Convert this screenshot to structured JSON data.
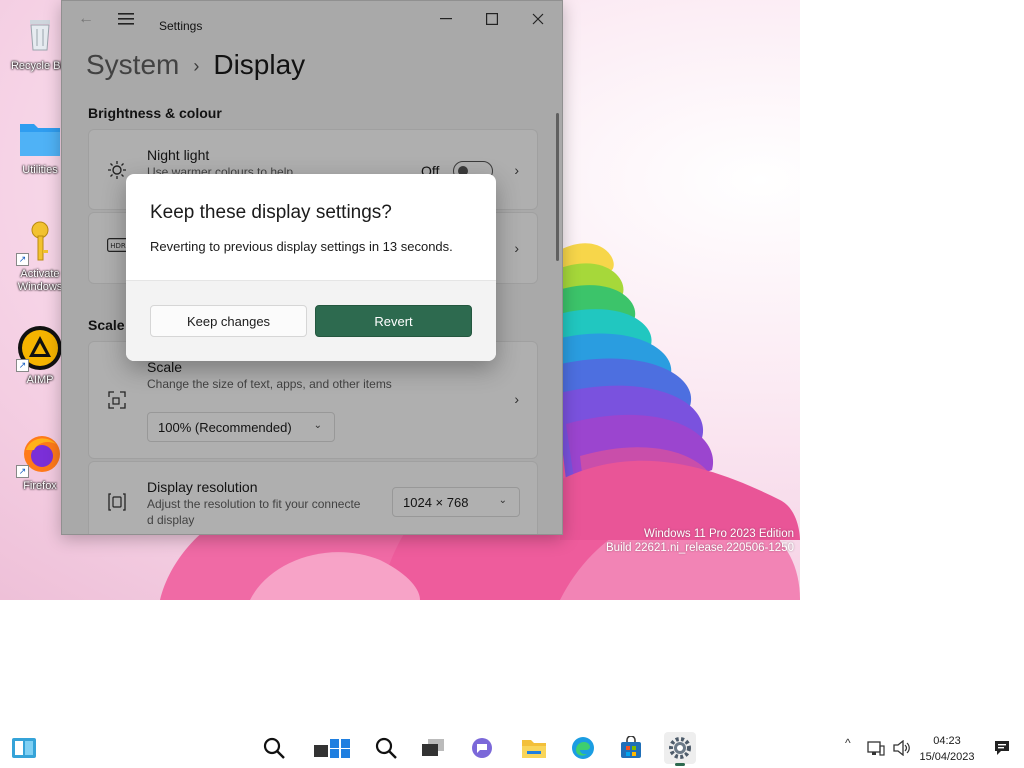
{
  "desktop": {
    "icons": [
      {
        "label": "Recycle Bin"
      },
      {
        "label": "Utilities"
      },
      {
        "label": "Activate Windows"
      },
      {
        "label": "AIMP"
      },
      {
        "label": "Firefox"
      }
    ],
    "watermark": {
      "line1": "Windows 11 Pro 2023 Edition",
      "line2": "Build 22621.ni_release.220506-1250"
    }
  },
  "window": {
    "app_title": "Settings",
    "breadcrumb_parent": "System",
    "breadcrumb_separator": "›",
    "page_title": "Display",
    "sections": {
      "brightness_header": "Brightness & colour",
      "scale_header": "Scale & layout"
    },
    "night_light": {
      "title": "Night light",
      "subtitle": "Use warmer colours to help",
      "state": "Off"
    },
    "scale": {
      "title": "Scale",
      "subtitle": "Change the size of text, apps, and other items",
      "value": "100% (Recommended)"
    },
    "resolution": {
      "title": "Display resolution",
      "subtitle_line1": "Adjust the resolution to fit your connecte",
      "subtitle_line2": "d display",
      "value": "1024 × 768"
    }
  },
  "dialog": {
    "title": "Keep these display settings?",
    "message": "Reverting to previous display settings in 13 seconds.",
    "keep_label": "Keep changes",
    "revert_label": "Revert"
  },
  "taskbar": {
    "time": "04:23",
    "date": "15/04/2023"
  },
  "colors": {
    "accent": "#2d6a4f"
  }
}
